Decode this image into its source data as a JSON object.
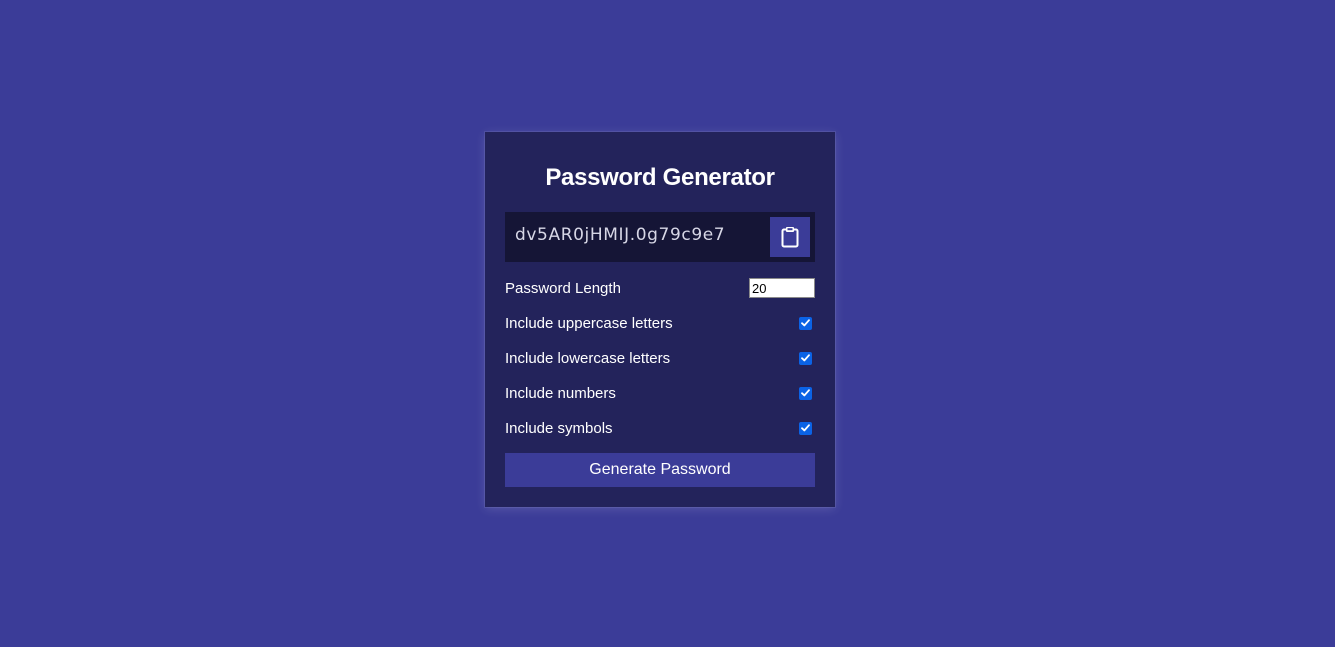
{
  "title": "Password Generator",
  "password": "dv5AR0jHMIJ.0g79c9e7",
  "clipboard_icon": "clipboard-icon",
  "settings": {
    "length_label": "Password Length",
    "length_value": "20",
    "uppercase_label": "Include uppercase letters",
    "uppercase_checked": true,
    "lowercase_label": "Include lowercase letters",
    "lowercase_checked": true,
    "numbers_label": "Include numbers",
    "numbers_checked": true,
    "symbols_label": "Include symbols",
    "symbols_checked": true
  },
  "generate_label": "Generate Password",
  "colors": {
    "background": "#3b3c98",
    "card": "#23235b",
    "result_bg": "#151536",
    "accent": "#3b3c98",
    "checkbox": "#0b63e6"
  }
}
